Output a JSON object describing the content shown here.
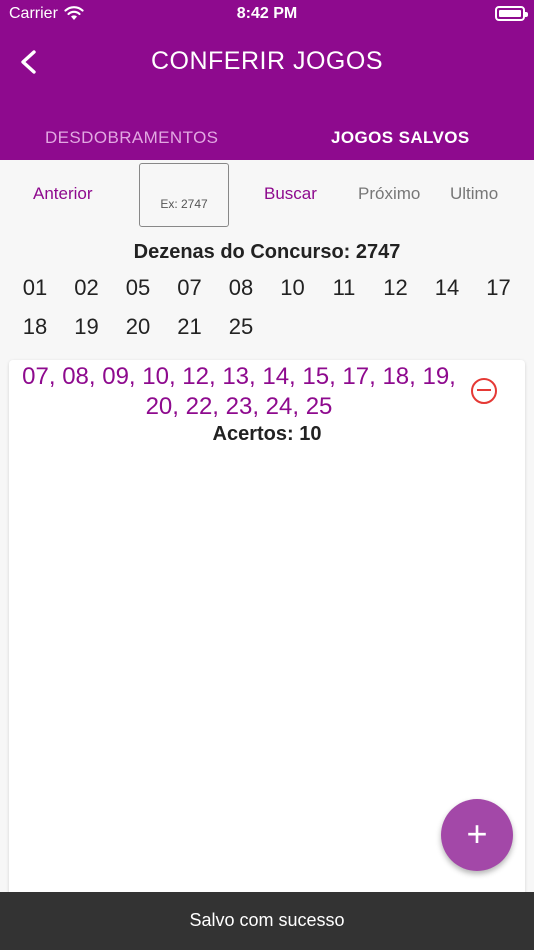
{
  "status": {
    "carrier": "Carrier",
    "time": "8:42 PM"
  },
  "header": {
    "title": "CONFERIR JOGOS"
  },
  "tabs": [
    {
      "label": "DESDOBRAMENTOS",
      "selected": false
    },
    {
      "label": "JOGOS SALVOS",
      "selected": true
    }
  ],
  "nav": {
    "anterior": "Anterior",
    "buscar": "Buscar",
    "proximo": "Próximo",
    "ultimo": "Ultimo"
  },
  "search": {
    "placeholder": "Ex: 2747",
    "value": ""
  },
  "contest": {
    "title": "Dezenas do Concurso: 2747",
    "numbers": [
      "01",
      "02",
      "05",
      "07",
      "08",
      "10",
      "11",
      "12",
      "14",
      "17",
      "18",
      "19",
      "20",
      "21",
      "25"
    ]
  },
  "saved_game": {
    "numbers_text": "07, 08, 09, 10, 12, 13, 14, 15, 17, 18, 19, 20, 22, 23, 24, 25",
    "hits": "Acertos: 10"
  },
  "fab": {
    "label": "+"
  },
  "toast": {
    "message": "Salvo com sucesso"
  },
  "colors": {
    "primary": "#8e0a8e",
    "fab": "#a348a8",
    "remove": "#e53935"
  }
}
